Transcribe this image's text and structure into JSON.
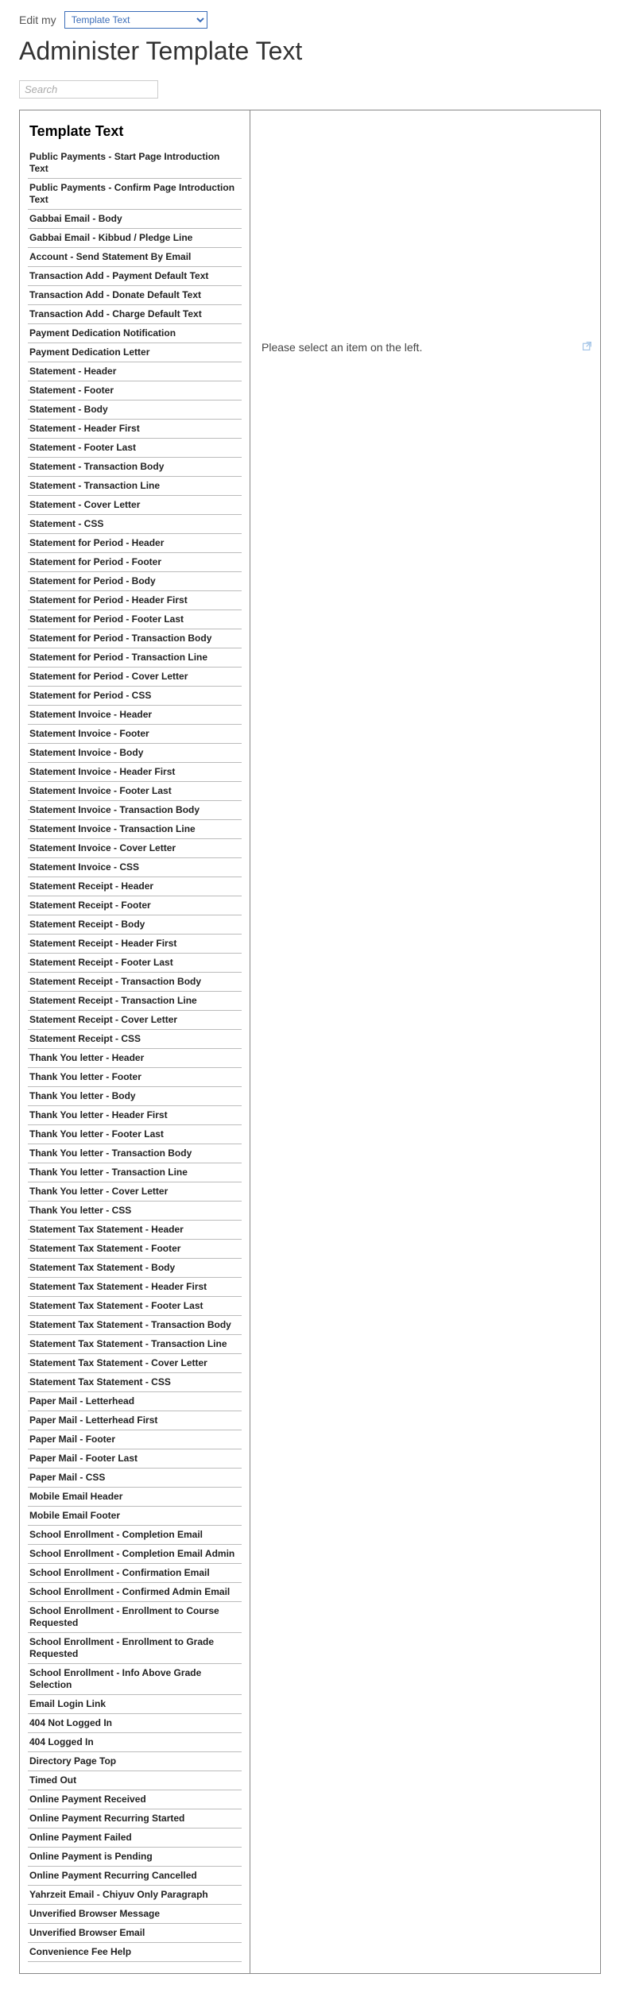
{
  "topbar": {
    "label": "Edit my",
    "dropdown_selected": "Template Text"
  },
  "page_title": "Administer Template Text",
  "search": {
    "placeholder": "Search",
    "value": ""
  },
  "left_panel_heading": "Template Text",
  "right_panel_message": "Please select an item on the left.",
  "items": [
    "Public Payments - Start Page Introduction Text",
    "Public Payments - Confirm Page Introduction Text",
    "Gabbai Email - Body",
    "Gabbai Email - Kibbud / Pledge Line",
    "Account - Send Statement By Email",
    "Transaction Add - Payment Default Text",
    "Transaction Add - Donate Default Text",
    "Transaction Add - Charge Default Text",
    "Payment Dedication Notification",
    "Payment Dedication Letter",
    "Statement - Header",
    "Statement - Footer",
    "Statement - Body",
    "Statement - Header First",
    "Statement - Footer Last",
    "Statement - Transaction Body",
    "Statement - Transaction Line",
    "Statement - Cover Letter",
    "Statement - CSS",
    "Statement for Period - Header",
    "Statement for Period - Footer",
    "Statement for Period - Body",
    "Statement for Period - Header First",
    "Statement for Period - Footer Last",
    "Statement for Period - Transaction Body",
    "Statement for Period - Transaction Line",
    "Statement for Period - Cover Letter",
    "Statement for Period - CSS",
    "Statement Invoice - Header",
    "Statement Invoice - Footer",
    "Statement Invoice - Body",
    "Statement Invoice - Header First",
    "Statement Invoice - Footer Last",
    "Statement Invoice - Transaction Body",
    "Statement Invoice - Transaction Line",
    "Statement Invoice - Cover Letter",
    "Statement Invoice - CSS",
    "Statement Receipt - Header",
    "Statement Receipt - Footer",
    "Statement Receipt - Body",
    "Statement Receipt - Header First",
    "Statement Receipt - Footer Last",
    "Statement Receipt - Transaction Body",
    "Statement Receipt - Transaction Line",
    "Statement Receipt - Cover Letter",
    "Statement Receipt - CSS",
    "Thank You letter - Header",
    "Thank You letter - Footer",
    "Thank You letter - Body",
    "Thank You letter - Header First",
    "Thank You letter - Footer Last",
    "Thank You letter - Transaction Body",
    "Thank You letter - Transaction Line",
    "Thank You letter - Cover Letter",
    "Thank You letter - CSS",
    "Statement Tax Statement - Header",
    "Statement Tax Statement - Footer",
    "Statement Tax Statement - Body",
    "Statement Tax Statement - Header First",
    "Statement Tax Statement - Footer Last",
    "Statement Tax Statement - Transaction Body",
    "Statement Tax Statement - Transaction Line",
    "Statement Tax Statement - Cover Letter",
    "Statement Tax Statement - CSS",
    "Paper Mail - Letterhead",
    "Paper Mail - Letterhead First",
    "Paper Mail - Footer",
    "Paper Mail - Footer Last",
    "Paper Mail - CSS",
    "Mobile Email Header",
    "Mobile Email Footer",
    "School Enrollment - Completion Email",
    "School Enrollment - Completion Email Admin",
    "School Enrollment - Confirmation Email",
    "School Enrollment - Confirmed Admin Email",
    "School Enrollment - Enrollment to Course Requested",
    "School Enrollment - Enrollment to Grade Requested",
    "School Enrollment - Info Above Grade Selection",
    "Email Login Link",
    "404 Not Logged In",
    "404 Logged In",
    "Directory Page Top",
    "Timed Out",
    "Online Payment Received",
    "Online Payment Recurring Started",
    "Online Payment Failed",
    "Online Payment is Pending",
    "Online Payment Recurring Cancelled",
    "Yahrzeit Email - Chiyuv Only Paragraph",
    "Unverified Browser Message",
    "Unverified Browser Email",
    "Convenience Fee Help"
  ]
}
